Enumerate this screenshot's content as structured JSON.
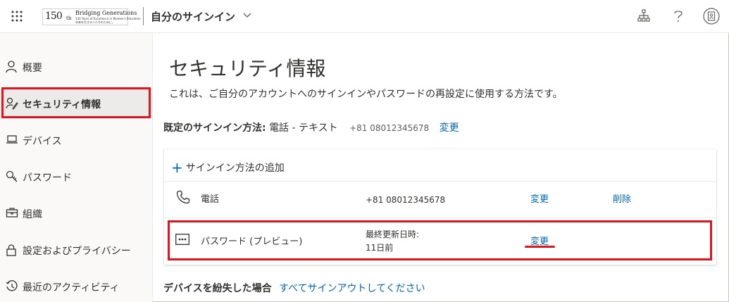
{
  "header": {
    "logo": {
      "number": "150",
      "suffix": "th",
      "line1": "Bridging Generations",
      "line2": "140 Years of Excellence in Women's Education",
      "line3": "未来を生きる人たちのために。"
    },
    "app_title": "自分のサインイン"
  },
  "sidebar": {
    "items": [
      {
        "label": "概要",
        "icon": "person-icon"
      },
      {
        "label": "セキュリティ情報",
        "icon": "security-info-icon"
      },
      {
        "label": "デバイス",
        "icon": "laptop-icon"
      },
      {
        "label": "パスワード",
        "icon": "key-icon"
      },
      {
        "label": "組織",
        "icon": "briefcase-icon"
      },
      {
        "label": "設定およびプライバシー",
        "icon": "lock-icon"
      },
      {
        "label": "最近のアクティビティ",
        "icon": "history-icon"
      }
    ]
  },
  "main": {
    "title": "セキュリティ情報",
    "description": "これは、ご自分のアカウントへのサインインやパスワードの再設定に使用する方法です。",
    "default_method": {
      "label": "既定のサインイン方法:",
      "value": "電話 - テキスト",
      "phone": "+81 08012345678",
      "change": "変更"
    },
    "add_method": "サインイン方法の追加",
    "methods": [
      {
        "name": "電話",
        "detail": "+81 08012345678",
        "change": "変更",
        "delete": "削除"
      },
      {
        "name": "パスワード (プレビュー)",
        "detail_label": "最終更新日時:",
        "detail_value": "11日前",
        "change": "変更"
      }
    ],
    "lost_device": {
      "label": "デバイスを紛失した場合",
      "link": "すべてサインアウトしてください"
    }
  },
  "colors": {
    "accent": "#0067b8",
    "highlight": "#e0151f",
    "sidebar_bg": "#faf9f8",
    "active_item_bg": "#edebe9"
  }
}
